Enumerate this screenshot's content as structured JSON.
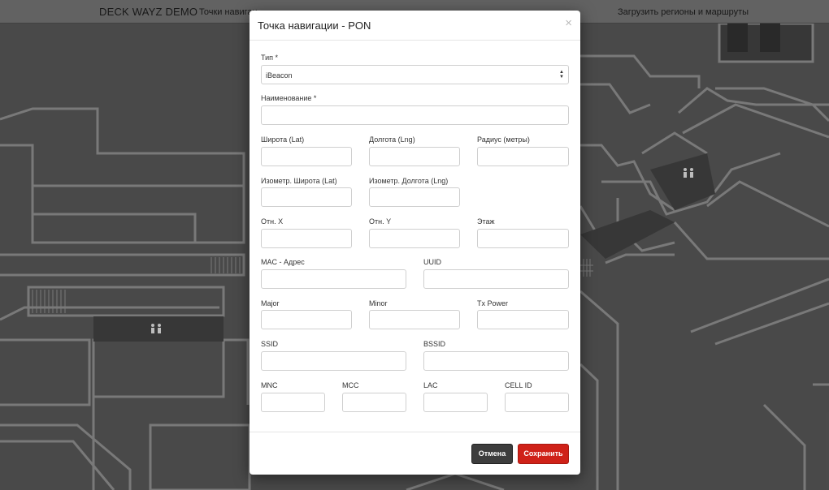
{
  "navbar": {
    "brand": "DECK WAYZ DEMO",
    "links": [
      "Точки навигац",
      "Загрузить регионы и маршруты"
    ]
  },
  "modal": {
    "title": "Точка навигации - PON",
    "close_icon": "×",
    "fields": {
      "type": {
        "label": "Тип *",
        "value": "iBeacon"
      },
      "name": {
        "label": "Наименование *",
        "value": ""
      },
      "lat": {
        "label": "Широта (Lat)",
        "value": ""
      },
      "lng": {
        "label": "Долгота (Lng)",
        "value": ""
      },
      "radius": {
        "label": "Радиус (метры)",
        "value": ""
      },
      "iso_lat": {
        "label": "Изометр. Широта (Lat)",
        "value": ""
      },
      "iso_lng": {
        "label": "Изометр. Долгота (Lng)",
        "value": ""
      },
      "rel_x": {
        "label": "Отн. X",
        "value": ""
      },
      "rel_y": {
        "label": "Отн. Y",
        "value": ""
      },
      "floor": {
        "label": "Этаж",
        "value": ""
      },
      "mac": {
        "label": "MAC - Адрес",
        "value": ""
      },
      "uuid": {
        "label": "UUID",
        "value": ""
      },
      "major": {
        "label": "Major",
        "value": ""
      },
      "minor": {
        "label": "Minor",
        "value": ""
      },
      "tx_power": {
        "label": "Tx Power",
        "value": ""
      },
      "ssid": {
        "label": "SSID",
        "value": ""
      },
      "bssid": {
        "label": "BSSID",
        "value": ""
      },
      "mnc": {
        "label": "MNC",
        "value": ""
      },
      "mcc": {
        "label": "MCC",
        "value": ""
      },
      "lac": {
        "label": "LAC",
        "value": ""
      },
      "cell_id": {
        "label": "CELL ID",
        "value": ""
      }
    },
    "buttons": {
      "cancel": "Отмена",
      "save": "Сохранить"
    }
  },
  "colors": {
    "save_button": "#cf2118",
    "cancel_button": "#3d3d3d",
    "map_background": "#545454"
  }
}
